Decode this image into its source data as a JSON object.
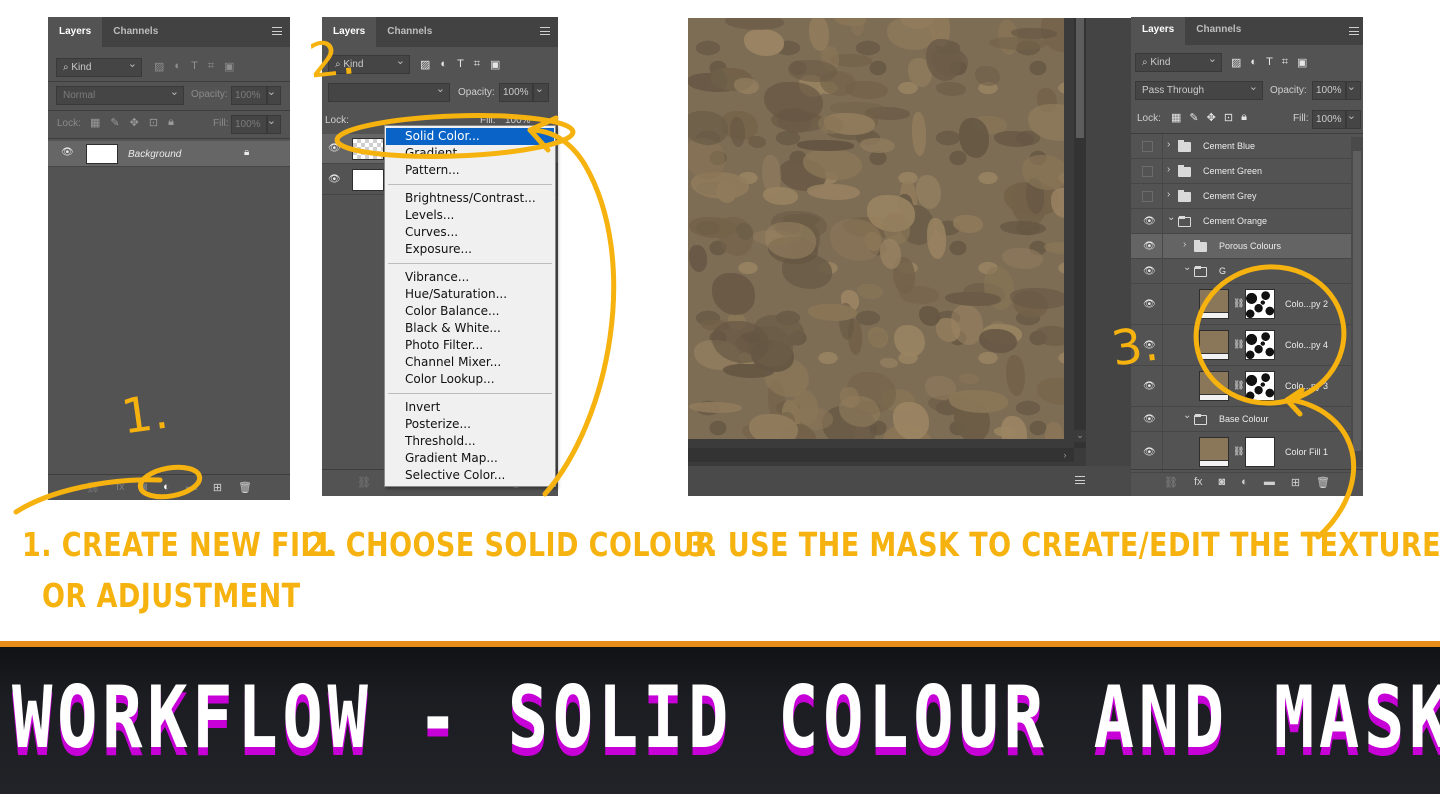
{
  "panel1": {
    "tabs": [
      "Layers",
      "Channels"
    ],
    "kind_label": "Kind",
    "blend_mode": "Normal",
    "opacity_label": "Opacity:",
    "opacity_value": "100%",
    "lock_label": "Lock:",
    "fill_label": "Fill:",
    "fill_value": "100%",
    "layers": [
      {
        "name": "Background",
        "locked": true
      }
    ]
  },
  "panel2": {
    "tabs": [
      "Layers",
      "Channels"
    ],
    "kind_label": "Kind",
    "opacity_label": "Opacity:",
    "opacity_value": "100%",
    "lock_label": "Lock:",
    "fill_label": "Fill:",
    "fill_value": "100%"
  },
  "dropdown": {
    "groups": [
      [
        "Solid Color...",
        "Gradient...",
        "Pattern..."
      ],
      [
        "Brightness/Contrast...",
        "Levels...",
        "Curves...",
        "Exposure..."
      ],
      [
        "Vibrance...",
        "Hue/Saturation...",
        "Color Balance...",
        "Black & White...",
        "Photo Filter...",
        "Channel Mixer...",
        "Color Lookup..."
      ],
      [
        "Invert",
        "Posterize...",
        "Threshold...",
        "Gradient Map...",
        "Selective Color..."
      ]
    ],
    "highlighted": "Solid Color..."
  },
  "panel3": {
    "tabs": [
      "Layers",
      "Channels"
    ],
    "kind_label": "Kind",
    "blend_mode": "Pass Through",
    "opacity_label": "Opacity:",
    "opacity_value": "100%",
    "lock_label": "Lock:",
    "fill_label": "Fill:",
    "fill_value": "100%",
    "layers": [
      {
        "name": "Cement Blue",
        "type": "group",
        "visible": false,
        "indent": 0,
        "open": false
      },
      {
        "name": "Cement Green",
        "type": "group",
        "visible": false,
        "indent": 0,
        "open": false
      },
      {
        "name": "Cement Grey",
        "type": "group",
        "visible": false,
        "indent": 0,
        "open": false
      },
      {
        "name": "Cement Orange",
        "type": "group",
        "visible": true,
        "indent": 0,
        "open": true
      },
      {
        "name": "Porous Colours",
        "type": "group",
        "visible": true,
        "indent": 1,
        "open": false,
        "selected": true
      },
      {
        "name": "G",
        "type": "group",
        "visible": true,
        "indent": 1,
        "open": true
      },
      {
        "name": "Colo...py 2",
        "type": "fill",
        "visible": true
      },
      {
        "name": "Colo...py 4",
        "type": "fill",
        "visible": true
      },
      {
        "name": "Colo...py 3",
        "type": "fill",
        "visible": true
      },
      {
        "name": "Base Colour",
        "type": "group",
        "visible": true,
        "indent": 1,
        "open": true
      },
      {
        "name": "Color Fill 1",
        "type": "fill",
        "visible": true
      }
    ]
  },
  "annotations": {
    "num1": "1.",
    "num2": "2.",
    "num3": "3.",
    "step1_line1": "1. CREATE NEW FILL",
    "step1_line2": "OR ADJUSTMENT",
    "step2": "2. CHOOSE SOLID COLOUR",
    "step3": "3. USE THE MASK TO CREATE/EDIT THE TEXTURE"
  },
  "banner": {
    "title": "WORKFLOW - SOLID COLOUR AND MASK"
  },
  "colors": {
    "annotation": "#f6b20e",
    "banner_border": "#e88c1a",
    "banner_shadow": "#c800d8",
    "highlight": "#0a64c8",
    "panel_bg": "#535353",
    "texture_base": "#7e6d55",
    "fill_swatch": "#8a7659"
  },
  "icons": [
    "search-icon",
    "image-filter-icon",
    "adjustment-filter-icon",
    "type-filter-icon",
    "shape-filter-icon",
    "smart-object-filter-icon",
    "lock-pixels-icon",
    "lock-paint-icon",
    "lock-move-icon",
    "lock-artboard-icon",
    "lock-all-icon",
    "eye-icon",
    "lock-icon",
    "link-icon",
    "fx-icon",
    "mask-icon",
    "adjustment-icon",
    "folder-icon",
    "new-layer-icon",
    "trash-icon",
    "chain-icon"
  ]
}
